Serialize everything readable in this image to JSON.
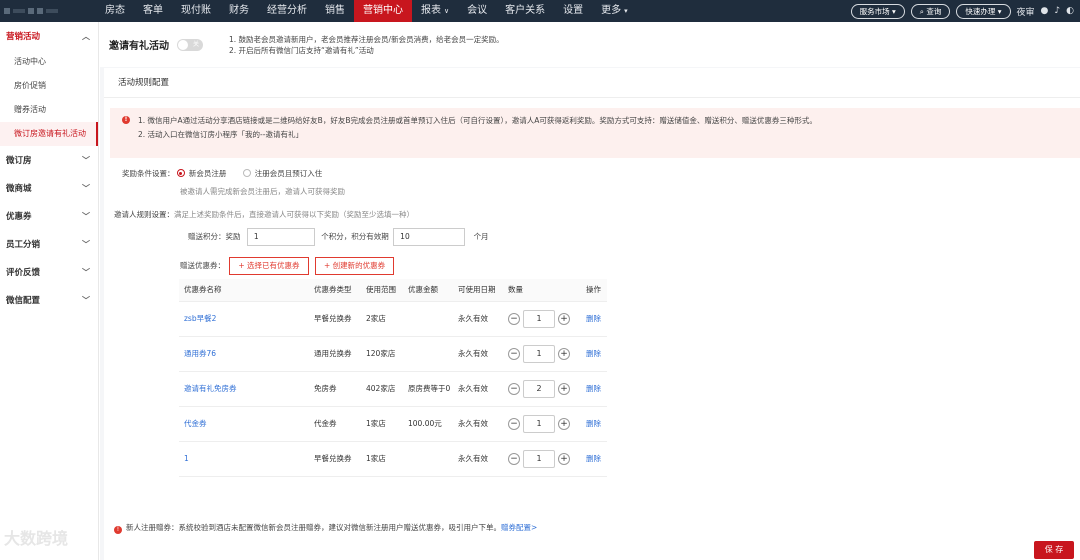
{
  "nav": {
    "items": [
      {
        "label": "房态"
      },
      {
        "label": "客单"
      },
      {
        "label": "现付账"
      },
      {
        "label": "财务"
      },
      {
        "label": "经营分析"
      },
      {
        "label": "销售"
      },
      {
        "label": "营销中心",
        "active": true
      },
      {
        "label": "报表",
        "caret": "∨"
      },
      {
        "label": "会议"
      },
      {
        "label": "客户关系"
      },
      {
        "label": "设置"
      },
      {
        "label": "更多",
        "caret": "▾"
      }
    ],
    "service_market": "服务市场 ▾",
    "search": "⌕ 查询",
    "quick": "快速办理 ▾",
    "night_audit": "夜审"
  },
  "sidebar": {
    "groups": [
      {
        "label": "营销活动",
        "active": true,
        "expanded": true,
        "items": [
          {
            "label": "活动中心"
          },
          {
            "label": "房价促销"
          },
          {
            "label": "赠券活动"
          },
          {
            "label": "微订房邀请有礼活动",
            "active": true
          }
        ]
      },
      {
        "label": "微订房"
      },
      {
        "label": "微商城"
      },
      {
        "label": "优惠券"
      },
      {
        "label": "员工分销"
      },
      {
        "label": "评价反馈"
      },
      {
        "label": "微信配置"
      }
    ]
  },
  "header": {
    "title": "邀请有礼活动",
    "toggle_label": "关",
    "note1": "1. 鼓励老会员邀请新用户，老会员推荐注册会员/新会员消费，给老会员一定奖励。",
    "note2": "2. 开启后所有微信门店支持“邀请有礼”活动"
  },
  "card": {
    "title": "活动规则配置",
    "alert1": "1. 微信用户A通过活动分享酒店链接或是二维码给好友B，好友B完成会员注册或首单预订入住后（可自行设置），邀请人A可获得返利奖励。奖励方式可支持：赠送储值金、赠送积分、赠送优惠券三种形式。",
    "alert2": "2. 活动入口在微信订房小程序「我的--邀请有礼」"
  },
  "form": {
    "condition_label": "奖励条件设置：",
    "option_new_member": "新会员注册",
    "option_member_booking": "注册会员且预订入住",
    "condition_hint": "被邀请人需完成新会员注册后，邀请人可获得奖励",
    "inviter_label": "邀请人规则设置：",
    "inviter_hint": "满足上述奖励条件后，直接邀请人可获得以下奖励（奖励至少选填一种）",
    "points_label": "赠送积分：",
    "reward_word": "奖励",
    "points_value": "1",
    "points_mid": "个积分，积分有效期",
    "validity_value": "10",
    "month_unit": "个月",
    "coupon_label": "赠送优惠券：",
    "select_coupon_btn": "+ 选择已有优惠券",
    "create_coupon_btn": "+ 创建新的优惠券"
  },
  "table": {
    "headers": [
      "优惠券名称",
      "优惠券类型",
      "使用范围",
      "优惠金额",
      "可使用日期",
      "数量",
      "操作"
    ],
    "rows": [
      {
        "name": "zsb早餐2",
        "type": "早餐兑换券",
        "scope": "2家店",
        "amount": "",
        "date": "永久有效",
        "qty": "1",
        "action": "删除"
      },
      {
        "name": "通用券76",
        "type": "通用兑换券",
        "scope": "120家店",
        "amount": "",
        "date": "永久有效",
        "qty": "1",
        "action": "删除"
      },
      {
        "name": "邀请有礼免房券",
        "type": "免房券",
        "scope": "402家店",
        "amount": "原房费等于0",
        "date": "永久有效",
        "qty": "2",
        "action": "删除"
      },
      {
        "name": "代金券",
        "type": "代金券",
        "scope": "1家店",
        "amount": "100.00元",
        "date": "永久有效",
        "qty": "1",
        "action": "删除"
      },
      {
        "name": "1",
        "type": "早餐兑换券",
        "scope": "1家店",
        "amount": "",
        "date": "永久有效",
        "qty": "1",
        "action": "删除"
      }
    ]
  },
  "footer": {
    "note": "新人注册赠券：系统校验到酒店未配置微信新会员注册赠券，建议对微信新注册用户赠送优惠券，吸引用户下单。",
    "link": "赠券配置>"
  },
  "save_label": "保 存",
  "watermark": "大数跨境"
}
